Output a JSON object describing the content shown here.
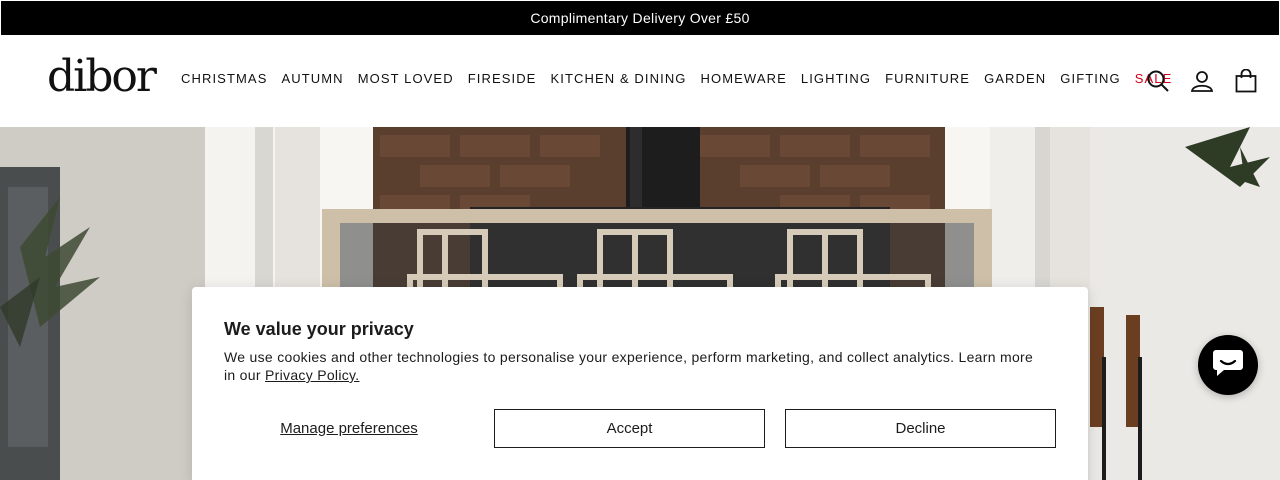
{
  "announcement": "Complimentary Delivery Over £50",
  "brand": {
    "logo_text": "dibor"
  },
  "nav": {
    "items": [
      {
        "label": "CHRISTMAS"
      },
      {
        "label": "AUTUMN"
      },
      {
        "label": "MOST LOVED"
      },
      {
        "label": "FIRESIDE"
      },
      {
        "label": "KITCHEN & DINING"
      },
      {
        "label": "HOMEWARE"
      },
      {
        "label": "LIGHTING"
      },
      {
        "label": "FURNITURE"
      },
      {
        "label": "GARDEN"
      },
      {
        "label": "GIFTING"
      },
      {
        "label": "SALE"
      }
    ],
    "sale_color": "#d0021b"
  },
  "header_icons": [
    "search-icon",
    "account-icon",
    "cart-icon"
  ],
  "cookie_banner": {
    "title": "We value your privacy",
    "body": "We use cookies and other technologies to personalise your experience, perform marketing, and collect analytics. Learn more in our ",
    "link_text": "Privacy Policy.",
    "manage_label": "Manage preferences",
    "accept_label": "Accept",
    "decline_label": "Decline"
  },
  "chat_widget": {
    "icon": "chat-bubble-icon"
  }
}
